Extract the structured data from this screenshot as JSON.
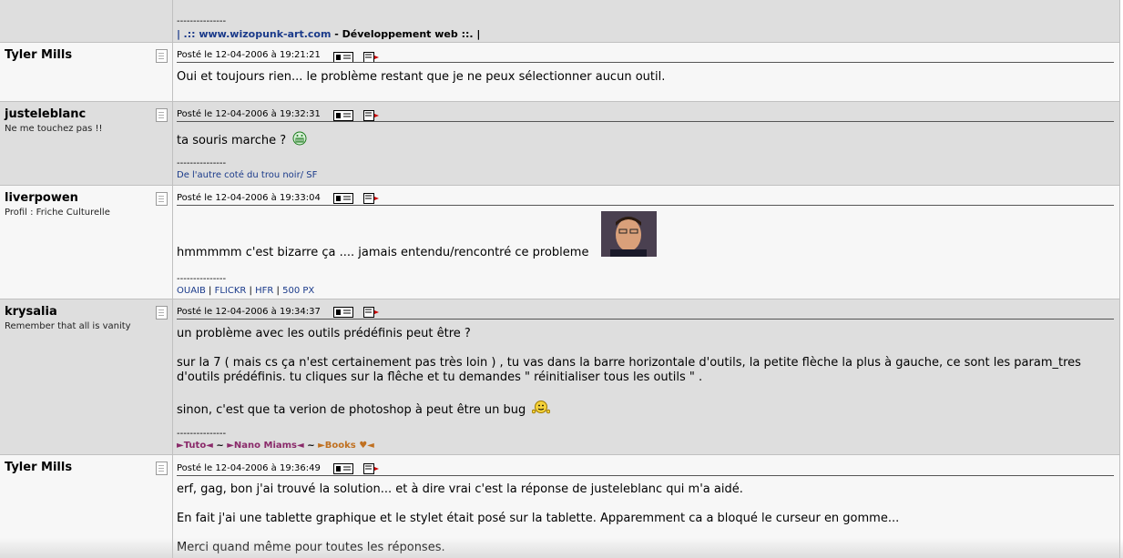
{
  "top_fragment": {
    "dashes": "---------------",
    "sig_pipe_left": "|",
    "sig_link": ".:: www.wizopunk-art.com",
    "sig_rest": " - Développement web ::. |"
  },
  "posts": [
    {
      "author": "Tyler Mills",
      "subtitle": "",
      "meta": "Posté le 12-04-2006 à 19:21:21",
      "lines": [
        "Oui et toujours rien... le problème restant que je ne peux sélectionner aucun outil."
      ]
    },
    {
      "author": "justeleblanc",
      "subtitle": "Ne me touchez pas !!",
      "meta": "Posté le 12-04-2006 à 19:32:31",
      "lines": [
        "ta souris marche ?"
      ],
      "dashes": "---------------",
      "signature": "De l'autre coté du trou noir/ SF"
    },
    {
      "author": "liverpowen",
      "subtitle": "Profil : Friche Culturelle",
      "meta": "Posté le 12-04-2006 à 19:33:04",
      "lines": [
        "hmmmmm c'est bizarre ça .... jamais entendu/rencontré ce probleme"
      ],
      "dashes": "---------------",
      "signature_links": [
        "OUAIB",
        "FLICKR",
        "HFR",
        "500 PX"
      ],
      "sep": "|"
    },
    {
      "author": "krysalia",
      "subtitle": "Remember that all is vanity",
      "meta": "Posté le 12-04-2006 à 19:34:37",
      "lines": [
        "un problème avec les outils prédéfinis peut être ?",
        "sur la 7 ( mais cs ça n'est certainement pas très loin ) , tu vas dans la barre horizontale d'outils, la petite flèche la plus à gauche, ce sont les param_tres",
        "d'outils prédéfinis. tu cliques sur la flêche et tu demandes \" réinitialiser tous les outils \" .",
        "sinon, c'est que ta verion de photoshop à peut être un bug"
      ],
      "dashes": "---------------",
      "sig_tuto": "►Tuto◄",
      "sig_tilde": "~",
      "sig_nano": "►Nano Miams◄",
      "sig_books": "►Books ♥◄"
    },
    {
      "author": "Tyler Mills",
      "subtitle": "",
      "meta": "Posté le 12-04-2006 à 19:36:49",
      "lines": [
        "erf, gag, bon j'ai trouvé la solution... et à dire vrai c'est la réponse de justeleblanc qui m'a aidé.",
        "En fait j'ai une tablette graphique et le stylet était posé sur la tablette. Apparemment ca a bloqué le curseur en gomme...",
        "Merci quand même pour toutes les réponses."
      ]
    }
  ],
  "colors": {
    "gray_row": "#dedede",
    "white_row": "#f7f7f7",
    "sig_blue": "#1a3a8a",
    "nano_purple": "#8a2a6a",
    "books_orange": "#c07020"
  }
}
